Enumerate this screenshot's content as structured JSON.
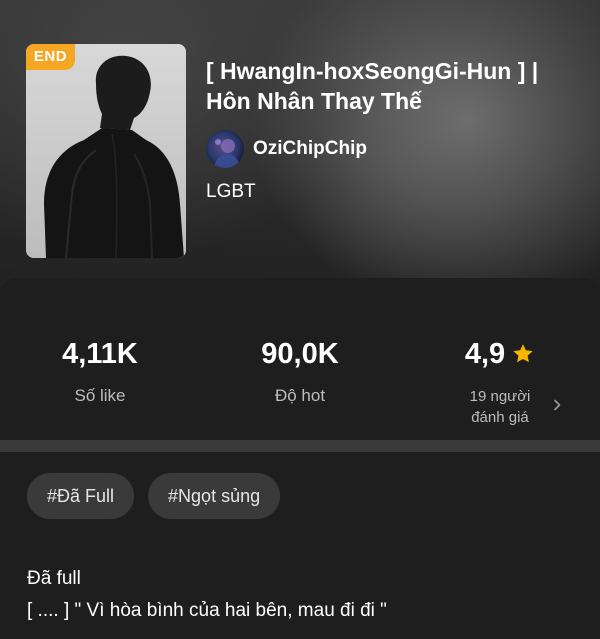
{
  "story": {
    "badge": "END",
    "title": "[ HwangIn-hoxSeongGi-Hun ] | Hôn Nhân Thay Thế",
    "author": "OziChipChip",
    "genre": "LGBT"
  },
  "stats": {
    "likes": {
      "value": "4,11K",
      "label": "Số like"
    },
    "hot": {
      "value": "90,0K",
      "label": "Độ hot"
    },
    "rating": {
      "value": "4,9",
      "count_line1": "19 người",
      "count_line2": "đánh giá"
    }
  },
  "tags": [
    "#Đã Full",
    "#Ngọt sủng"
  ],
  "description": {
    "line1": "Đã full",
    "line2": "[ .... ] \" Vì hòa bình của hai bên, mau đi đi \""
  },
  "colors": {
    "badge": "#f5a623",
    "star": "#f5b400",
    "panel": "#1e1e1e",
    "tag_bg": "#3a3a3a",
    "muted_text": "#bdbdbd"
  },
  "icons": {
    "rating": "star-icon",
    "more": "chevron-right-icon"
  }
}
